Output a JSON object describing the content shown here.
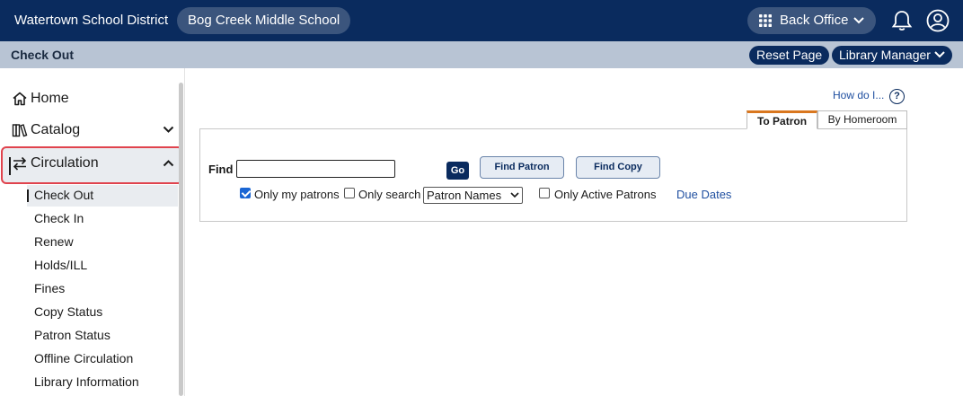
{
  "header": {
    "district": "Watertown School District",
    "school": "Bog Creek Middle School",
    "back_office": "Back Office",
    "icons": [
      "grid-icon",
      "chevron-down-icon",
      "bell-icon",
      "user-icon"
    ]
  },
  "subbar": {
    "title": "Check Out",
    "reset_page": "Reset Page",
    "library_manager": "Library Manager"
  },
  "sidebar": {
    "top_items": [
      {
        "label": "Home",
        "icon": "home-icon"
      },
      {
        "label": "Catalog",
        "icon": "books-icon",
        "expanded": false
      },
      {
        "label": "Circulation",
        "icon": "swap-arrows-icon",
        "expanded": true
      }
    ],
    "sub_items": [
      "Check Out",
      "Check In",
      "Renew",
      "Holds/ILL",
      "Fines",
      "Copy Status",
      "Patron Status",
      "Offline Circulation",
      "Library Information"
    ],
    "selected": "Check Out"
  },
  "main": {
    "how_do_i": "How do I...",
    "help": "?",
    "tabs": [
      {
        "label": "To Patron",
        "active": true
      },
      {
        "label": "By Homeroom",
        "active": false
      }
    ],
    "find_label": "Find",
    "find_value": "",
    "go": "Go",
    "find_patron": "Find Patron",
    "find_copy": "Find Copy",
    "only_my_patrons": {
      "label": "Only my patrons",
      "checked": true
    },
    "only_search": {
      "label": "Only search",
      "checked": false
    },
    "search_select": "Patron Names",
    "only_active": {
      "label": "Only Active Patrons",
      "checked": false
    },
    "due_dates": "Due Dates"
  },
  "colors": {
    "header_bg": "#0a2b5e",
    "pill_bg": "#3b557d",
    "subbar_bg": "#b8c4d4",
    "highlight_border": "#e0434d",
    "tab_accent": "#d9771f",
    "link": "#1f4fa0"
  }
}
